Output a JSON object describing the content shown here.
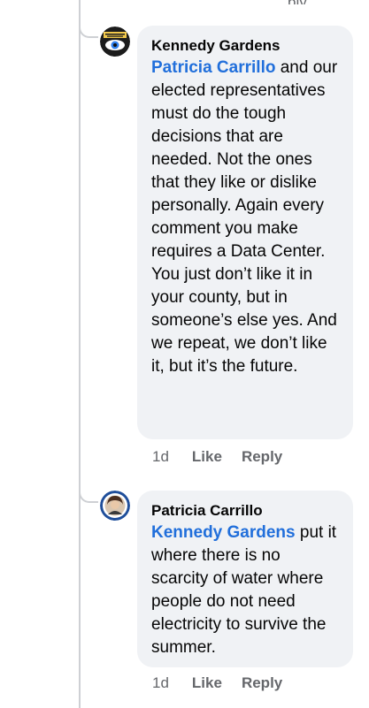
{
  "top_fragment": "ply",
  "comments": [
    {
      "author": "Kennedy Gardens",
      "avatar_icon": "kennedy-gardens-logo-icon",
      "mention": "Patricia Carrillo",
      "text": " and our elected representatives must do the tough decisions that are needed. Not the ones that they like or dislike personally. Again every comment you make requires a Data Center. You just don’t like it in your county, but in someone’s else yes. And we repeat, we don’t like it, but it’s the future.",
      "time": "1d",
      "like_label": "Like",
      "reply_label": "Reply"
    },
    {
      "author": "Patricia Carrillo",
      "avatar_icon": "user-avatar-icon",
      "mention": "Kennedy Gardens",
      "text": " put it where there is no scarcity of water where people do not need electricity to survive the summer.",
      "time": "1d",
      "like_label": "Like",
      "reply_label": "Reply"
    }
  ],
  "colors": {
    "bubble": "#f0f2f5",
    "mention": "#216fdb",
    "meta": "#65676b",
    "thread": "#ced0d4"
  }
}
